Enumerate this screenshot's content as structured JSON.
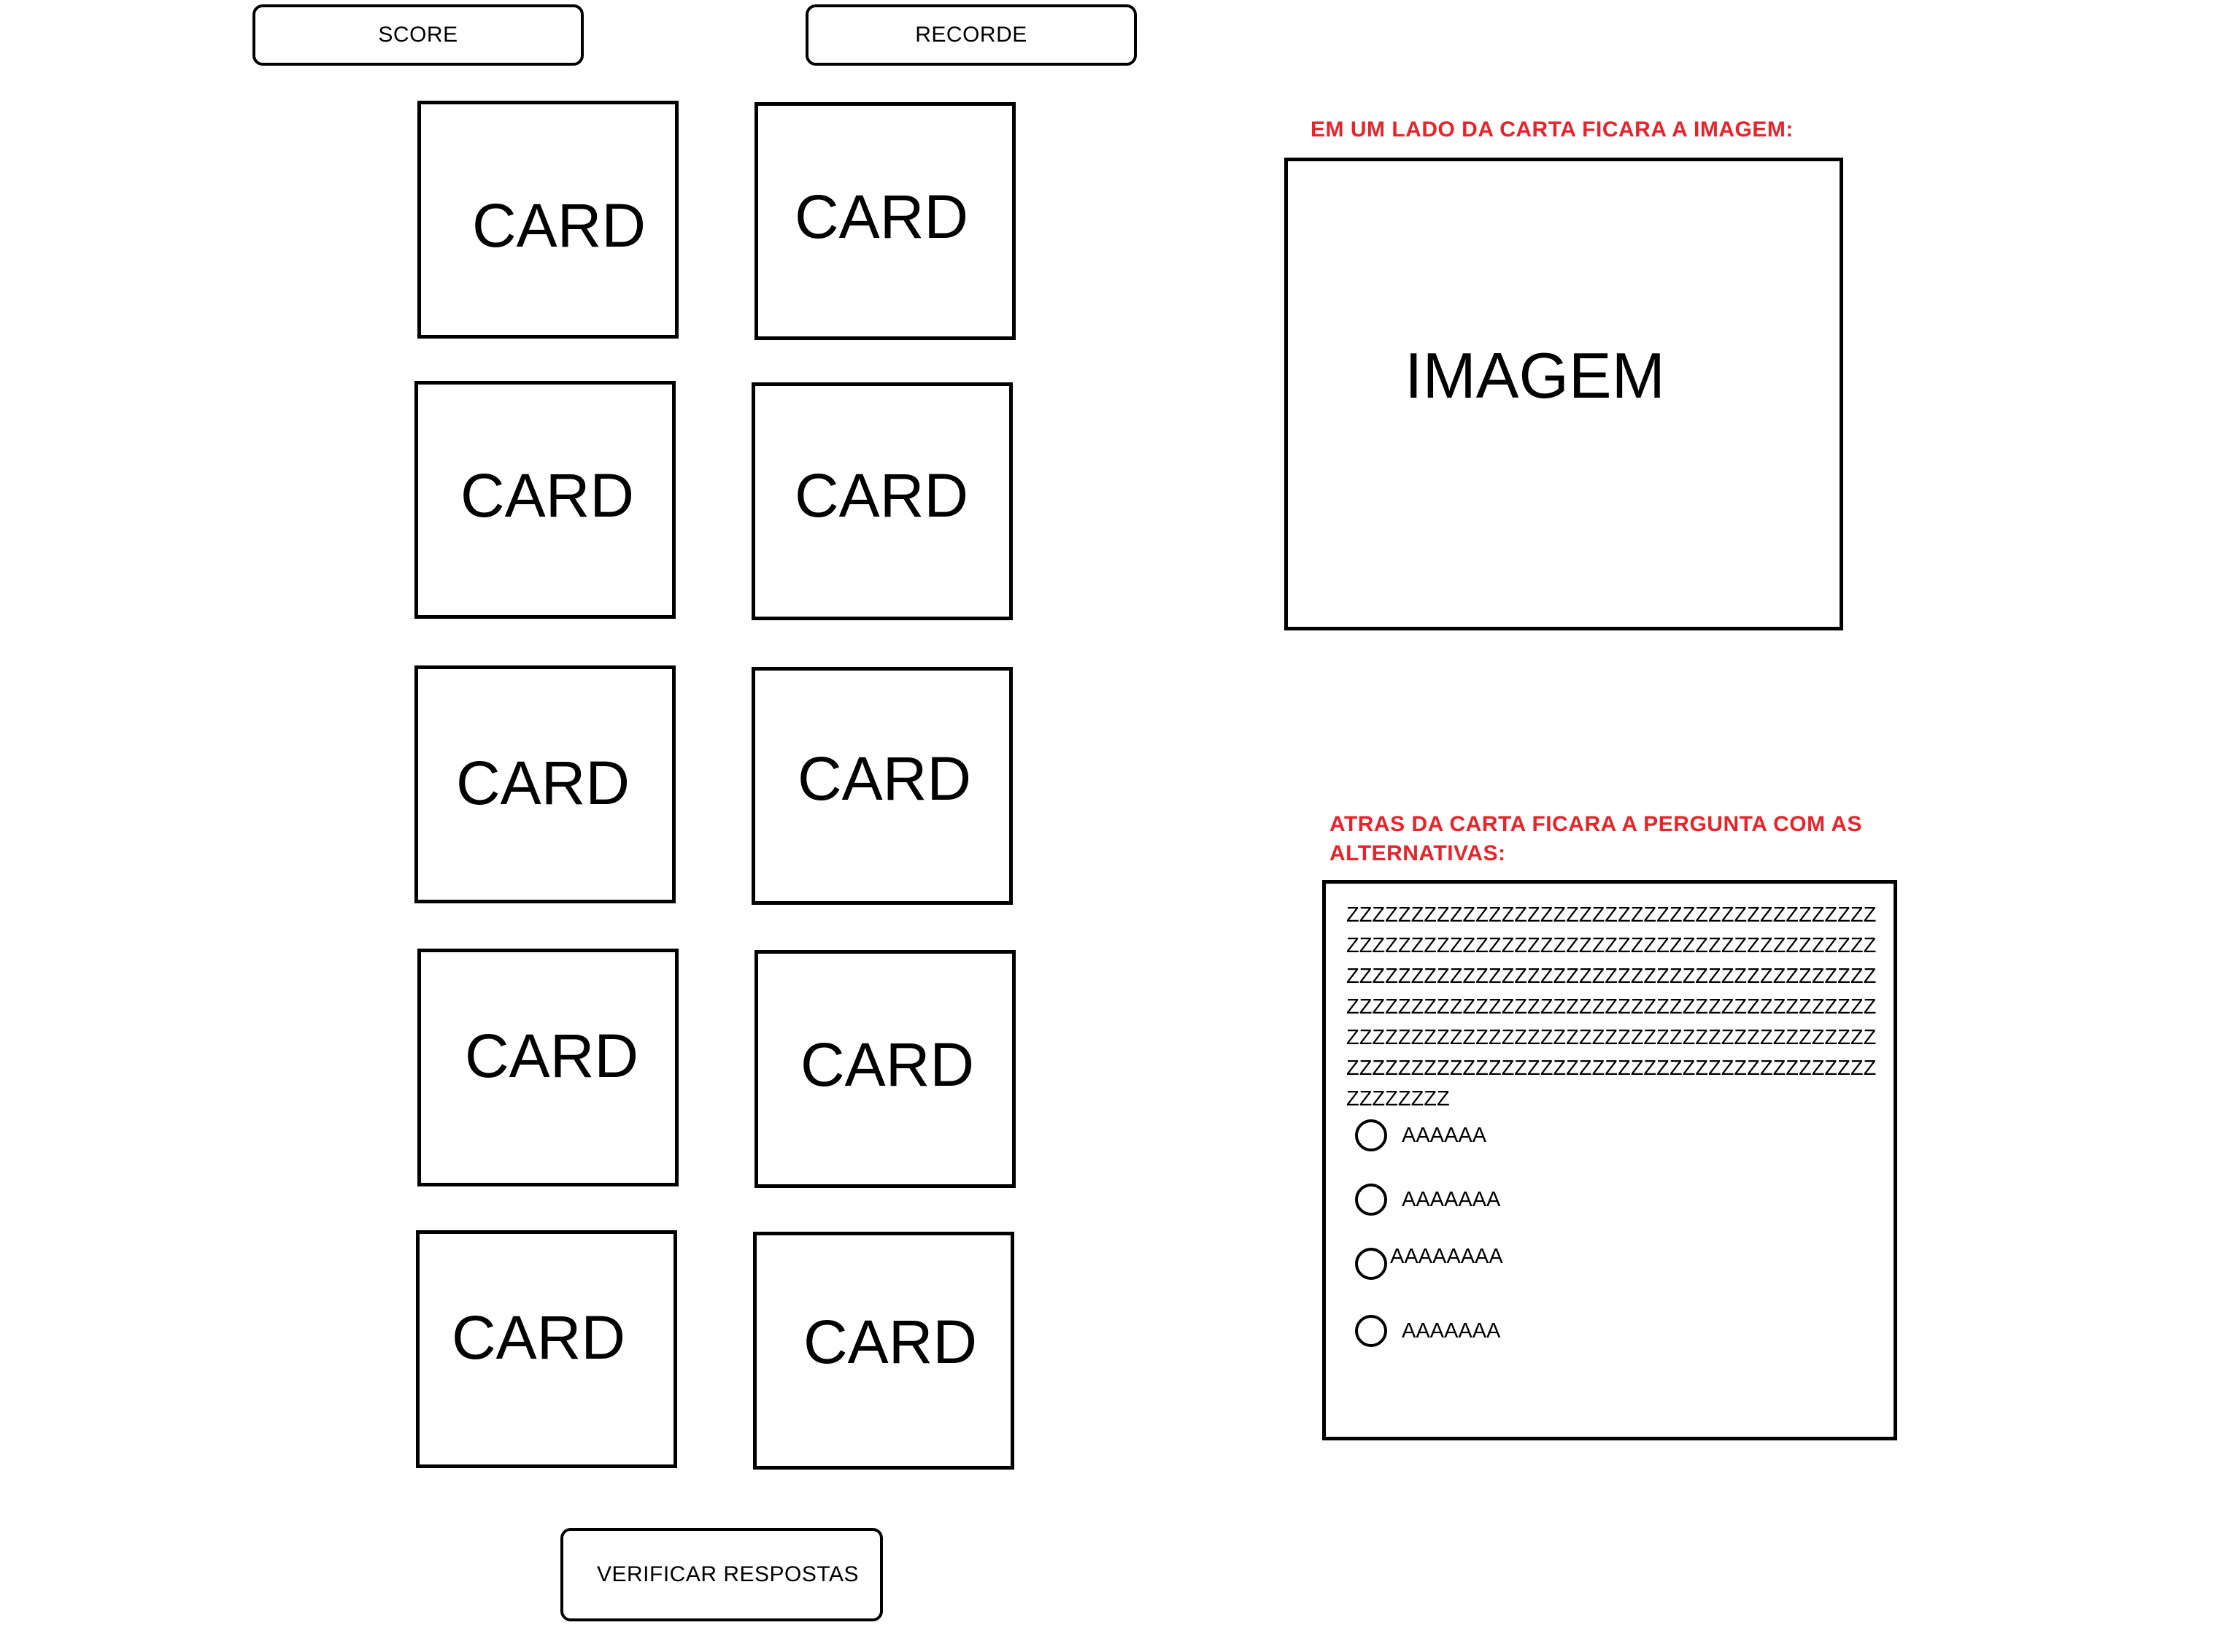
{
  "header": {
    "score_label": "SCORE",
    "recorde_label": "RECORDE"
  },
  "cards": [
    {
      "label": "CARD"
    },
    {
      "label": "CARD"
    },
    {
      "label": "CARD"
    },
    {
      "label": "CARD"
    },
    {
      "label": "CARD"
    },
    {
      "label": "CARD"
    },
    {
      "label": "CARD"
    },
    {
      "label": "CARD"
    },
    {
      "label": "CARD"
    },
    {
      "label": "CARD"
    }
  ],
  "verify_button_label": "VERIFICAR RESPOSTAS",
  "front_side": {
    "note": "EM UM LADO DA CARTA FICARA A IMAGEM:",
    "image_label": "IMAGEM"
  },
  "back_side": {
    "note_line1": "ATRAS DA CARTA FICARA A PERGUNTA COM AS",
    "note_line2": "ALTERNATIVAS:",
    "question": "ZZZZZZZZZZZZZZZZZZZZZZZZZZZZZZZZZZZZZZZZZZZZZZZZZZZZZZZZZZZZZZZZZZZZZZZZZZZZZZZZZZZZZZZZZZZZZZZZZZZZZZZZZZZZZZZZZZZZZZZZZZZZZZZZZZZZZZZZZZZZZZZZZZZZZZZZZZZZZZZZZZZZZZZZZZZZZZZZZZZZZZZZZZZZZZZZZZZZZZZZZZZZZZZZZZZZZZZZZZZZZZZZZZZZZZZZZZZZZZZZZZZZZZZZZZZZZZ",
    "options": [
      {
        "label": "AAAAAA"
      },
      {
        "label": "AAAAAAA"
      },
      {
        "label": "AAAAAAAA"
      },
      {
        "label": "AAAAAAA"
      }
    ]
  },
  "colors": {
    "note_red": "#e8232a",
    "border": "#000000",
    "background": "#ffffff"
  }
}
